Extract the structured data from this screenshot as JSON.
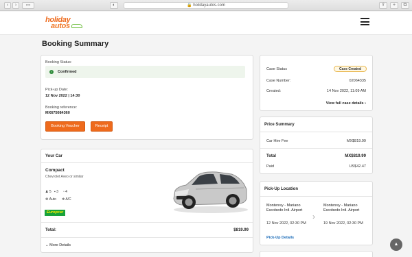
{
  "browser": {
    "url": "holidayautos.com"
  },
  "header": {
    "logo_line1": "holiday",
    "logo_line2": "autos"
  },
  "page": {
    "title": "Booking Summary"
  },
  "booking": {
    "status_label": "Booking Status:",
    "status_value": "Confirmed",
    "pickup_label": "Pick-up Date:",
    "pickup_value": "12 Nov 2022 | 14:30",
    "ref_label": "Booking reference:",
    "ref_value": "MX675084360",
    "voucher_button": "Booking Voucher",
    "receipt_button": "Receipt"
  },
  "car": {
    "section_title": "Your Car",
    "category": "Compact",
    "model": "Chevrolet Aveo or similar",
    "seats": "5",
    "bags": "3",
    "doors": "4",
    "transmission": "Auto",
    "ac": "A/C",
    "supplier": "Europcar",
    "total_label": "Total:",
    "total_value": "$819.99",
    "more_details": "More Details"
  },
  "case": {
    "status_label": "Case Status",
    "status_value": "Case Created",
    "number_label": "Case Number:",
    "number_value": "02064335",
    "created_label": "Created:",
    "created_value": "14 Nov 2022, 11:09 AM",
    "view_link": "View full case details"
  },
  "price": {
    "title": "Price Summary",
    "hire_label": "Car Hire Fee",
    "hire_value": "MX$819.99",
    "total_label": "Total",
    "total_value": "MX$819.99",
    "paid_label": "Paid",
    "paid_value": "US$42.47"
  },
  "pickup": {
    "title": "Pick-Up Location",
    "from_name": "Monterrey - Mariano Escobedo Intl. Airport",
    "from_date": "12 Nov 2022, 02:30 PM",
    "to_name": "Monterrey - Mariano Escobedo Intl. Airport",
    "to_date": "19 Nov 2022, 02:30 PM",
    "details_link": "Pick-Up Details"
  },
  "colors": {
    "accent": "#ee6a1c",
    "confirmed": "#2e8b3a",
    "link": "#1a6bb8"
  }
}
